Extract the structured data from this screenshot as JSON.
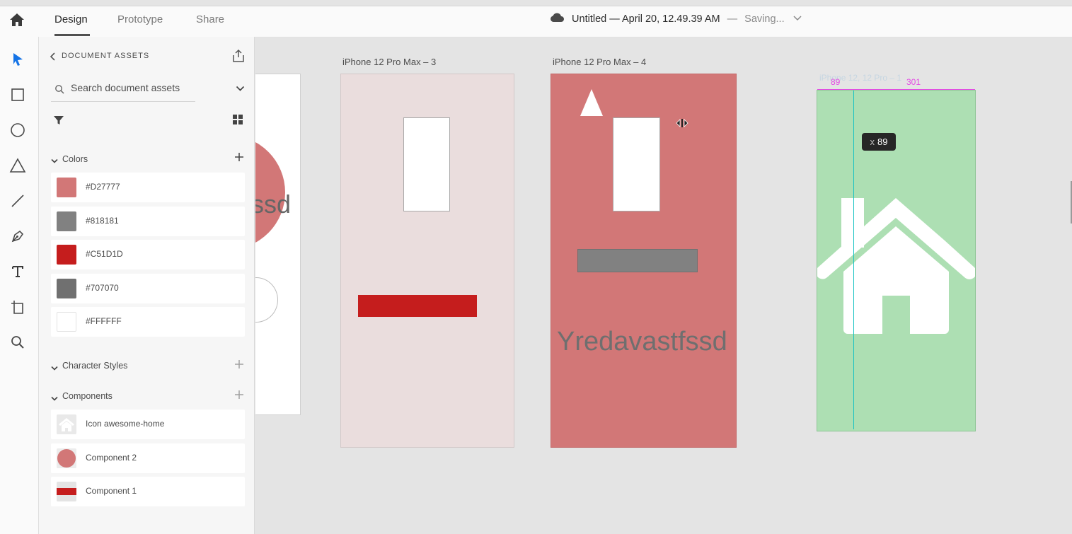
{
  "topbar": {
    "tabs": [
      "Design",
      "Prototype",
      "Share"
    ],
    "doc_title": "Untitled — April 20, 12.49.39 AM",
    "separator": "—",
    "status": "Saving..."
  },
  "assets": {
    "header": "DOCUMENT ASSETS",
    "search_placeholder": "Search document assets",
    "colors_title": "Colors",
    "colors": [
      {
        "hex": "#D27777",
        "label": "#D27777"
      },
      {
        "hex": "#818181",
        "label": "#818181"
      },
      {
        "hex": "#C51D1D",
        "label": "#C51D1D"
      },
      {
        "hex": "#707070",
        "label": "#707070"
      },
      {
        "hex": "#FFFFFF",
        "label": "#FFFFFF"
      }
    ],
    "character_styles_title": "Character Styles",
    "components_title": "Components",
    "components": [
      {
        "label": "Icon awesome-home",
        "icon": "home-icon"
      },
      {
        "label": "Component 2",
        "icon": "circle-thumb"
      },
      {
        "label": "Component 1",
        "icon": "rect-thumb"
      }
    ]
  },
  "canvas": {
    "artboard_left_text": "ssd",
    "artboard3_title": "iPhone 12 Pro Max – 3",
    "artboard4_title": "iPhone 12 Pro Max – 4",
    "artboard4_text": "Yredavastfssd",
    "artboard5_title": "iPhone 12, 12 Pro – 1",
    "guide_left": "89",
    "guide_right": "301",
    "tooltip_axis": "x",
    "tooltip_value": "89"
  },
  "colors": {
    "accent": "#1473e6",
    "pink": "#D27777",
    "red": "#C51D1D",
    "gray": "#818181",
    "green": "#ADDFB3",
    "light_pink": "#EADDDD",
    "guide_magenta": "#e44be4",
    "guide_cyan": "#19c3c3"
  }
}
